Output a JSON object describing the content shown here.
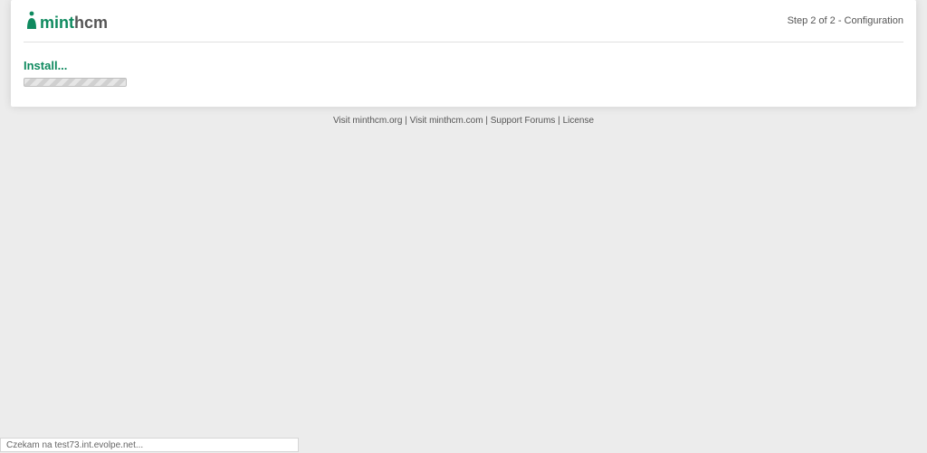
{
  "header": {
    "logo_text_mint": "mint",
    "logo_text_hcm": "hcm",
    "step_text": "Step 2 of 2 - Configuration"
  },
  "content": {
    "install_title": "Install..."
  },
  "footer": {
    "link1": "Visit minthcm.org",
    "sep": " | ",
    "link2": "Visit minthcm.com",
    "link3": "Support Forums",
    "link4": "License"
  },
  "status_bar": {
    "text": "Czekam na test73.int.evolpe.net..."
  }
}
